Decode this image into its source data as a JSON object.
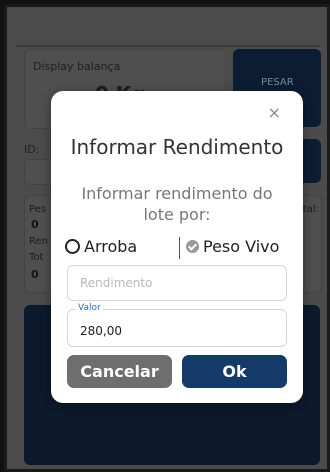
{
  "background": {
    "display_label": "Display balança",
    "display_value": "0 Kg",
    "pesar_label": "PESAR",
    "id_label": "ID:",
    "info": {
      "left_lines": [
        "Pes",
        "0",
        "Ren",
        "Tot",
        "0"
      ],
      "right_label": "tal:"
    }
  },
  "modal": {
    "close_glyph": "×",
    "title": "Informar Rendimento",
    "subtitle": "Informar rendimento do lote por:",
    "options": {
      "arroba": "Arroba",
      "peso_vivo": "Peso Vivo",
      "selected": "Peso Vivo"
    },
    "rendimento_placeholder": "Rendimento",
    "valor_label": "Valor",
    "valor_value": "280,00",
    "cancel_label": "Cancelar",
    "ok_label": "Ok"
  },
  "colors": {
    "overlay": "#4b4b4b",
    "dark_navy": "#0c1d33",
    "ok_button": "#143a6a",
    "cancel_button": "#6e6e6e",
    "floating_label": "#2b6dc4"
  }
}
